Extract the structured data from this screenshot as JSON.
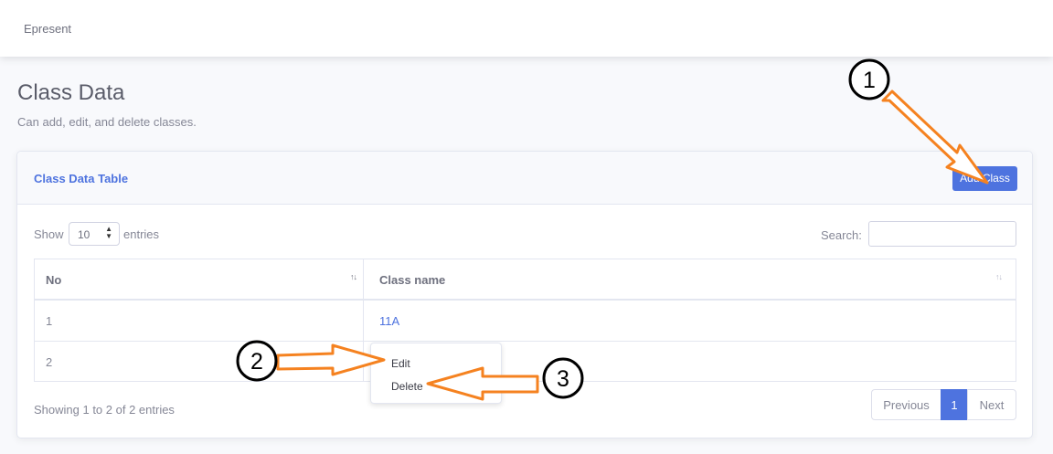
{
  "topbar": {
    "brand": "Epresent"
  },
  "page": {
    "title": "Class Data",
    "subtitle": "Can add, edit, and delete classes."
  },
  "card": {
    "title": "Class Data Table",
    "add_button": "Add Class"
  },
  "table_controls": {
    "show_label": "Show",
    "entries_value": "10",
    "entries_label": "entries",
    "search_label": "Search:",
    "search_value": ""
  },
  "table": {
    "headers": [
      "No",
      "Class name"
    ],
    "rows": [
      {
        "no": "1",
        "class_name": "11A"
      },
      {
        "no": "2",
        "class_name": ""
      }
    ]
  },
  "context_menu": {
    "items": [
      "Edit",
      "Delete"
    ]
  },
  "footer": {
    "info": "Showing 1 to 2 of 2 entries",
    "pagination": {
      "previous": "Previous",
      "current": "1",
      "next": "Next"
    }
  },
  "annotations": {
    "markers": [
      "1",
      "2",
      "3"
    ]
  },
  "colors": {
    "primary": "#4e73df",
    "annotation_arrow": "#f58220",
    "page_background": "#f8f9fc"
  }
}
